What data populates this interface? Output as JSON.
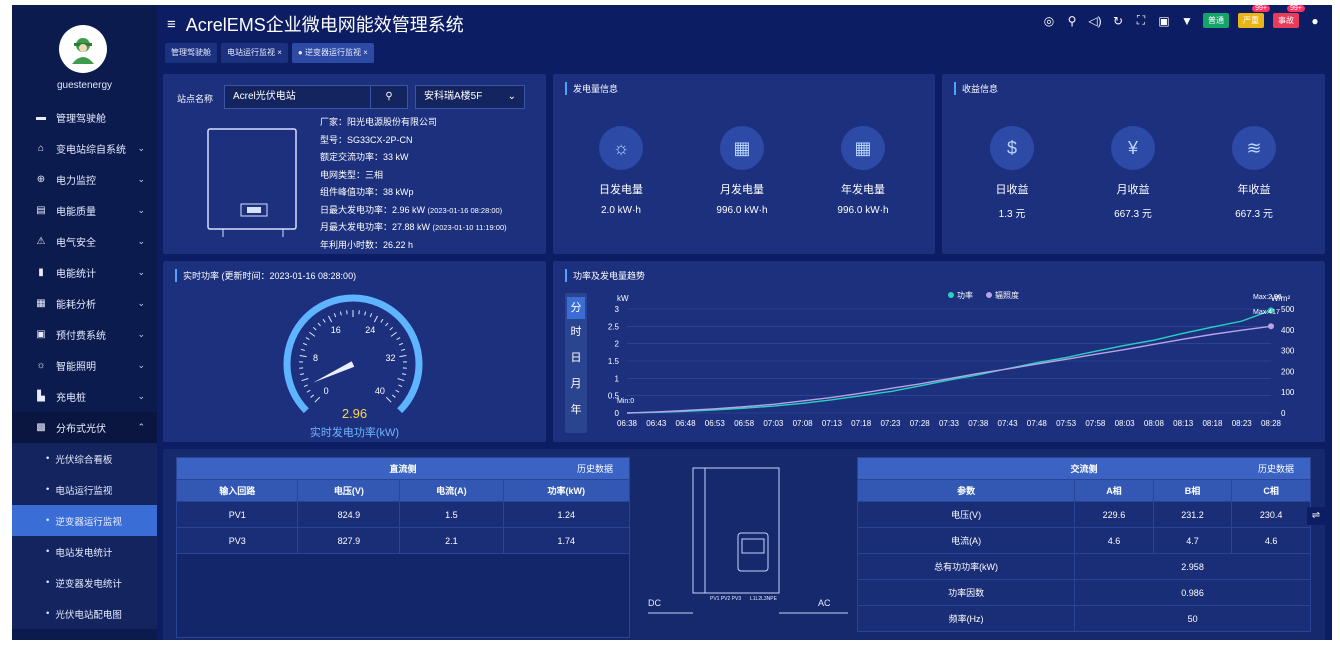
{
  "user": {
    "name": "guestenergy"
  },
  "menu": [
    {
      "icon": "▬",
      "label": "管理驾驶舱",
      "chev": ""
    },
    {
      "icon": "⌂",
      "label": "变电站综自系统",
      "chev": "⌄"
    },
    {
      "icon": "⊕",
      "label": "电力监控",
      "chev": "⌄"
    },
    {
      "icon": "▤",
      "label": "电能质量",
      "chev": "⌄"
    },
    {
      "icon": "⚠",
      "label": "电气安全",
      "chev": "⌄"
    },
    {
      "icon": "▮",
      "label": "电能统计",
      "chev": "⌄"
    },
    {
      "icon": "▦",
      "label": "能耗分析",
      "chev": "⌄"
    },
    {
      "icon": "▣",
      "label": "预付费系统",
      "chev": "⌄"
    },
    {
      "icon": "☼",
      "label": "智能照明",
      "chev": "⌄"
    },
    {
      "icon": "▙",
      "label": "充电桩",
      "chev": "⌄"
    },
    {
      "icon": "▩",
      "label": "分布式光伏",
      "chev": "⌃"
    }
  ],
  "submenu": [
    {
      "label": "光伏综合看板"
    },
    {
      "label": "电站运行监视"
    },
    {
      "label": "逆变器运行监视"
    },
    {
      "label": "电站发电统计"
    },
    {
      "label": "逆变器发电统计"
    },
    {
      "label": "光伏电站配电图"
    }
  ],
  "header": {
    "title": "AcrelEMS企业微电网能效管理系统",
    "tag_normal": "普通",
    "tag_serious": "严重",
    "tag_accident": "事故",
    "badge_serious": "99+",
    "badge_accident": "99+"
  },
  "tabs": [
    {
      "label": "管理驾驶舱"
    },
    {
      "label": "电站运行监视 ×"
    },
    {
      "label": "● 逆变器运行监视 ×"
    }
  ],
  "station": {
    "label": "站点名称",
    "value": "Acrel光伏电站",
    "select": "安科瑞A楼5F",
    "select_chev": "⌄"
  },
  "inverter_info": [
    "厂家：阳光电源股份有限公司",
    "型号：SG33CX-2P-CN",
    "额定交流功率：33 kW",
    "电网类型：三相",
    "组件峰值功率：38 kWp",
    "日最大发电功率：2.96 kW",
    "月最大发电功率：27.88 kW",
    "年利用小时数：26.22 h"
  ],
  "inverter_info_times": {
    "day": "(2023-01-16 08:28:00)",
    "month": "(2023-01-10 11:19:00)"
  },
  "generation": {
    "title": "发电量信息",
    "items": [
      {
        "label": "日发电量",
        "value": "2.0 kW·h",
        "icon": "sun-icon"
      },
      {
        "label": "月发电量",
        "value": "996.0 kW·h",
        "icon": "calendar-icon"
      },
      {
        "label": "年发电量",
        "value": "996.0 kW·h",
        "icon": "calendar-icon"
      }
    ]
  },
  "income": {
    "title": "收益信息",
    "items": [
      {
        "label": "日收益",
        "value": "1.3 元",
        "icon": "hand-coin-icon"
      },
      {
        "label": "月收益",
        "value": "667.3 元",
        "icon": "money-bag-icon"
      },
      {
        "label": "年收益",
        "value": "667.3 元",
        "icon": "coins-icon"
      }
    ]
  },
  "realtime": {
    "title": "实时功率 (更新时间：2023-01-16 08:28:00)",
    "value": "2.96",
    "caption": "实时发电功率(kW)",
    "ticks": [
      "0",
      "8",
      "16",
      "24",
      "32",
      "40"
    ],
    "max": 40
  },
  "trend": {
    "title": "功率及发电量趋势",
    "modes": [
      "分",
      "时",
      "日",
      "月",
      "年"
    ],
    "legend": [
      "功率",
      "辐照度"
    ],
    "y_left_unit": "kW",
    "y_right_unit": "W/m²",
    "max_label": "Max:2.96",
    "max2_label": "Max:417",
    "min_label": "Min:0"
  },
  "chart_data": {
    "type": "line",
    "x": [
      "06:38",
      "06:43",
      "06:48",
      "06:53",
      "06:58",
      "07:03",
      "07:08",
      "07:13",
      "07:18",
      "07:23",
      "07:28",
      "07:33",
      "07:38",
      "07:43",
      "07:48",
      "07:53",
      "07:58",
      "08:03",
      "08:08",
      "08:13",
      "08:18",
      "08:23",
      "08:28"
    ],
    "ylim_left": [
      0,
      3
    ],
    "yticks_left": [
      "0",
      "0.5",
      "1",
      "1.5",
      "2",
      "2.5",
      "3"
    ],
    "ylim_right": [
      0,
      500
    ],
    "yticks_right": [
      "0",
      "100",
      "200",
      "300",
      "400",
      "500"
    ],
    "series": [
      {
        "name": "功率",
        "axis": "left",
        "color": "#2ad1c0",
        "values": [
          0,
          0.02,
          0.05,
          0.09,
          0.14,
          0.2,
          0.28,
          0.38,
          0.5,
          0.62,
          0.78,
          0.95,
          1.1,
          1.28,
          1.45,
          1.6,
          1.78,
          1.95,
          2.1,
          2.3,
          2.48,
          2.65,
          2.96
        ]
      },
      {
        "name": "辐照度",
        "axis": "right",
        "color": "#b9a2e8",
        "values": [
          0,
          5,
          12,
          20,
          30,
          42,
          58,
          75,
          95,
          118,
          140,
          165,
          190,
          212,
          235,
          258,
          282,
          305,
          330,
          355,
          378,
          398,
          417
        ]
      }
    ]
  },
  "dc": {
    "title": "直流侧",
    "history": "历史数据",
    "headers": [
      "输入回路",
      "电压(V)",
      "电流(A)",
      "功率(kW)"
    ],
    "rows": [
      [
        "PV1",
        "824.9",
        "1.5",
        "1.24"
      ],
      [
        "PV3",
        "827.9",
        "2.1",
        "1.74"
      ]
    ]
  },
  "diagram": {
    "dc": "DC",
    "ac": "AC",
    "pv_labels": "PV1 PV2 PV3",
    "ac_labels": "L1L2L3NPE"
  },
  "ac": {
    "title": "交流侧",
    "history": "历史数据",
    "headers": [
      "参数",
      "A相",
      "B相",
      "C相"
    ],
    "rows": [
      [
        "电压(V)",
        "229.6",
        "231.2",
        "230.4"
      ],
      [
        "电流(A)",
        "4.6",
        "4.7",
        "4.6"
      ]
    ],
    "merged": [
      [
        "总有功功率(kW)",
        "2.958"
      ],
      [
        "功率因数",
        "0.986"
      ],
      [
        "频率(Hz)",
        "50"
      ]
    ]
  },
  "colors": {
    "accent": "#4ea3ff",
    "bg": "#0d1d63",
    "panel": "#1c307d",
    "active": "#3a6ed6"
  }
}
